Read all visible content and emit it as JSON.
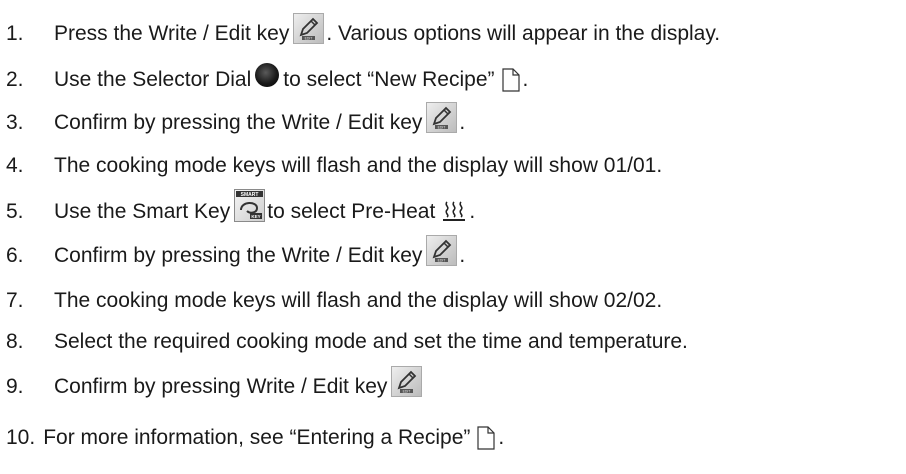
{
  "steps": [
    {
      "num": "1.",
      "pre": "Press the Write / Edit key",
      "icon": "edit-key-icon",
      "post": ". Various options will appear in the display."
    },
    {
      "num": "2.",
      "pre": "Use the Selector Dial",
      "icon": "selector-dial-icon",
      "post": "to select “New Recipe”",
      "icon2": "document-icon",
      "post2": "."
    },
    {
      "num": "3.",
      "pre": "Confirm by pressing the Write / Edit key",
      "icon": "edit-key-icon",
      "post": "."
    },
    {
      "num": "4.",
      "pre": "The cooking mode keys will flash and the display will show 01/01."
    },
    {
      "num": "5.",
      "pre": "Use the Smart Key",
      "icon": "smart-key-icon",
      "post": "to select Pre-Heat",
      "icon2": "preheat-icon",
      "post2": "."
    },
    {
      "num": "6.",
      "pre": "Confirm by pressing the Write / Edit key",
      "icon": "edit-key-icon",
      "post": "."
    },
    {
      "num": "7.",
      "pre": "The cooking mode keys will flash and the display will show 02/02."
    },
    {
      "num": "8.",
      "pre": "Select the required cooking mode and set the time and temperature."
    },
    {
      "num": "9.",
      "pre": "Confirm by pressing Write / Edit key",
      "icon": "edit-key-icon"
    },
    {
      "num": "10.",
      "pre": "For more information, see “Entering a Recipe”",
      "icon": "document-icon",
      "post": "."
    }
  ],
  "icon_labels": {
    "edit_key": "EDIT",
    "smart_key_top": "SMART",
    "smart_key_bottom": "KEY"
  }
}
